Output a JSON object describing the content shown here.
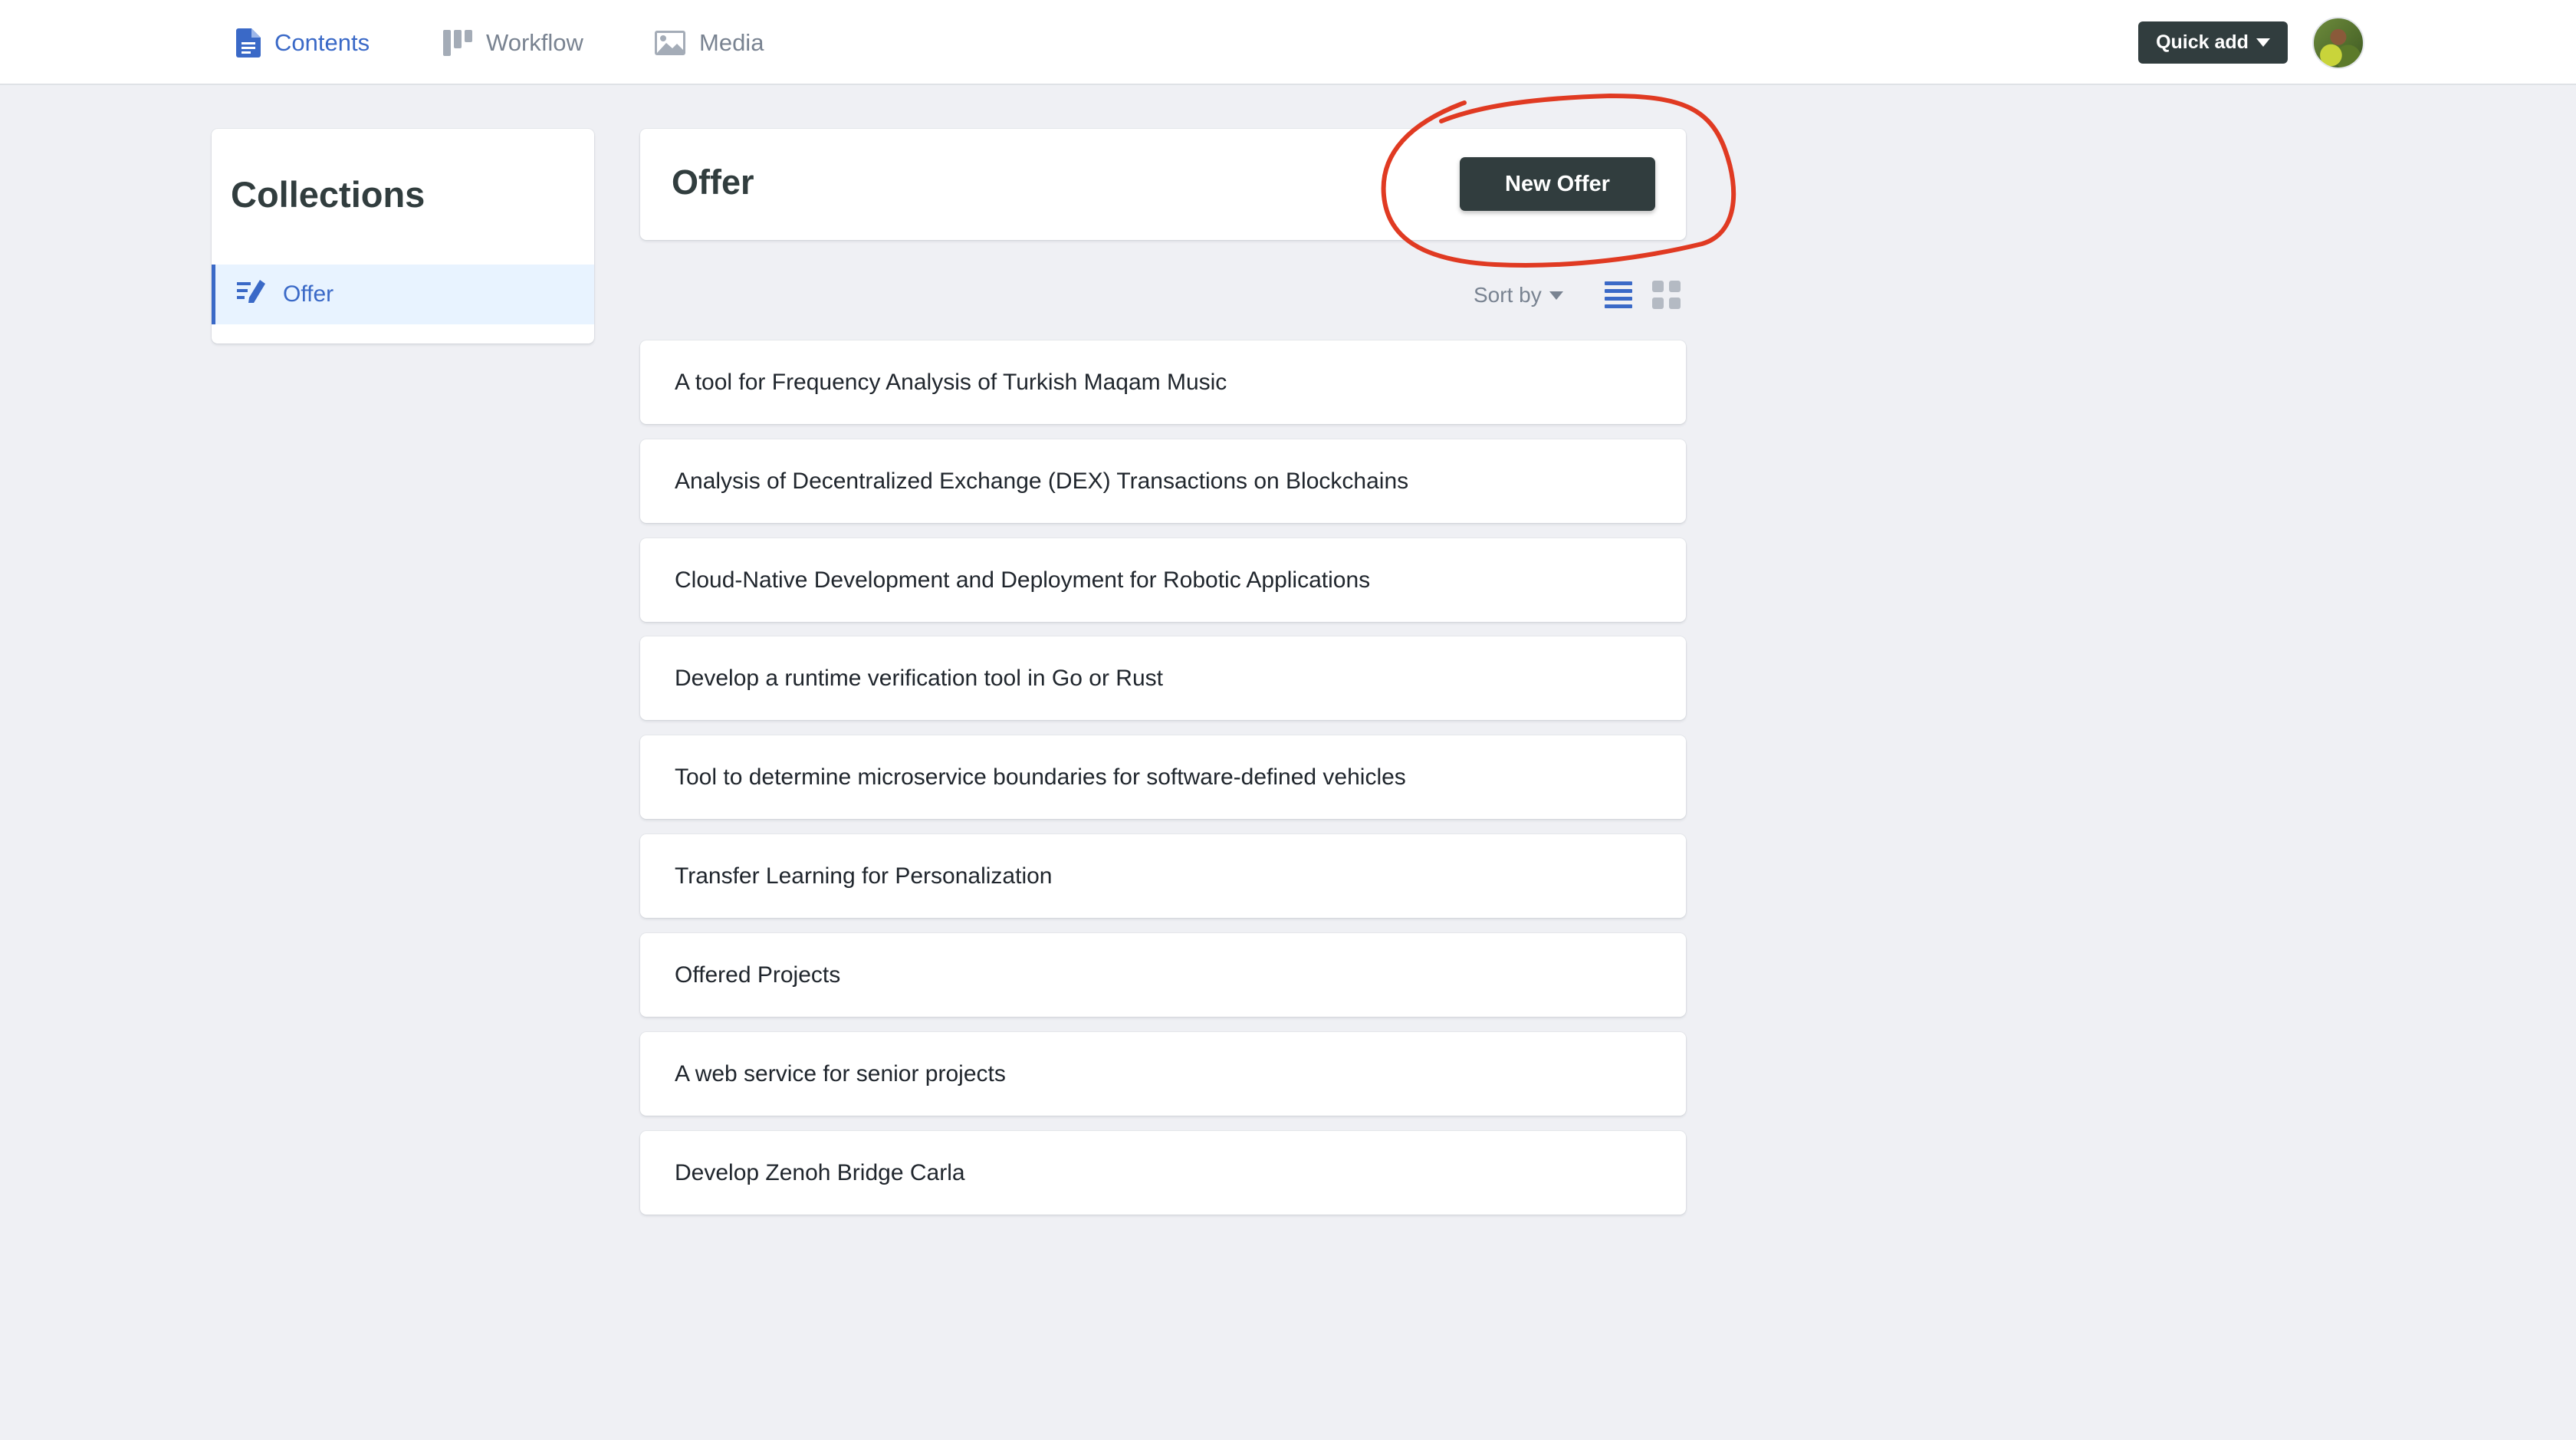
{
  "topnav": {
    "items": [
      {
        "label": "Contents",
        "icon": "document-icon",
        "active": true
      },
      {
        "label": "Workflow",
        "icon": "workflow-icon",
        "active": false
      },
      {
        "label": "Media",
        "icon": "image-icon",
        "active": false
      }
    ],
    "quick_add_label": "Quick add"
  },
  "sidebar": {
    "title": "Collections",
    "items": [
      {
        "label": "Offer",
        "icon": "write-icon",
        "selected": true
      }
    ]
  },
  "collection": {
    "title": "Offer",
    "new_button_label": "New Offer",
    "sort_label": "Sort by",
    "view_mode": "list"
  },
  "entries": [
    "A tool for Frequency Analysis of Turkish Maqam Music",
    "Analysis of Decentralized Exchange (DEX) Transactions on Blockchains",
    "Cloud-Native Development and Deployment for Robotic Applications",
    "Develop a runtime verification tool in Go or Rust",
    "Tool to determine microservice boundaries for software-defined vehicles",
    "Transfer Learning for Personalization",
    "Offered Projects",
    "A web service for senior projects",
    "Develop Zenoh Bridge Carla"
  ],
  "colors": {
    "accent": "#3a69c7",
    "dark_button": "#313d3e",
    "background": "#eff0f4",
    "annotation": "#e03a22"
  }
}
